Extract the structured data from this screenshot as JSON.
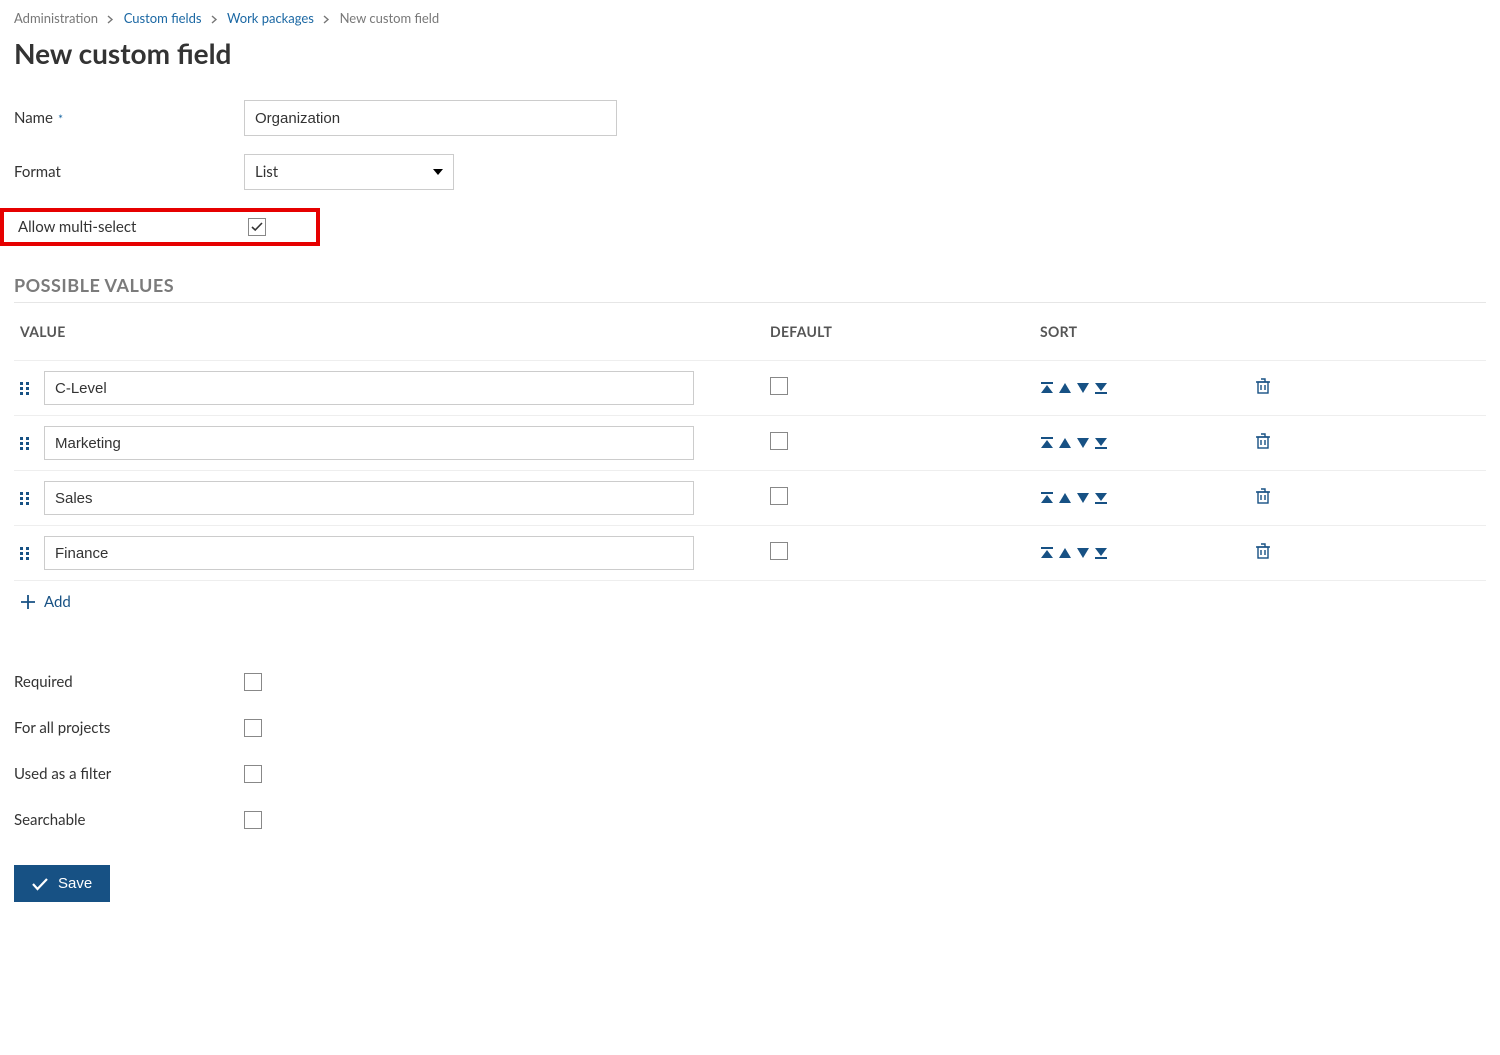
{
  "breadcrumb": {
    "administration": "Administration",
    "custom_fields": "Custom fields",
    "work_packages": "Work packages",
    "new_custom_field": "New custom field"
  },
  "page_title": "New custom field",
  "labels": {
    "name": "Name",
    "format": "Format",
    "allow_multi": "Allow multi-select",
    "required": "Required",
    "for_all_projects": "For all projects",
    "used_as_filter": "Used as a filter",
    "searchable": "Searchable"
  },
  "values": {
    "name": "Organization",
    "format": "List",
    "allow_multi_checked": true,
    "required_checked": false,
    "for_all_projects_checked": false,
    "used_as_filter_checked": false,
    "searchable_checked": false
  },
  "possible_values": {
    "title": "POSSIBLE VALUES",
    "headers": {
      "value": "VALUE",
      "default": "DEFAULT",
      "sort": "SORT"
    },
    "rows": [
      {
        "value": "C-Level",
        "default": false
      },
      {
        "value": "Marketing",
        "default": false
      },
      {
        "value": "Sales",
        "default": false
      },
      {
        "value": "Finance",
        "default": false
      }
    ],
    "add_label": "Add"
  },
  "save_label": "Save",
  "colors": {
    "primary": "#175184",
    "link": "#1a67a3",
    "highlight": "#e60000"
  }
}
